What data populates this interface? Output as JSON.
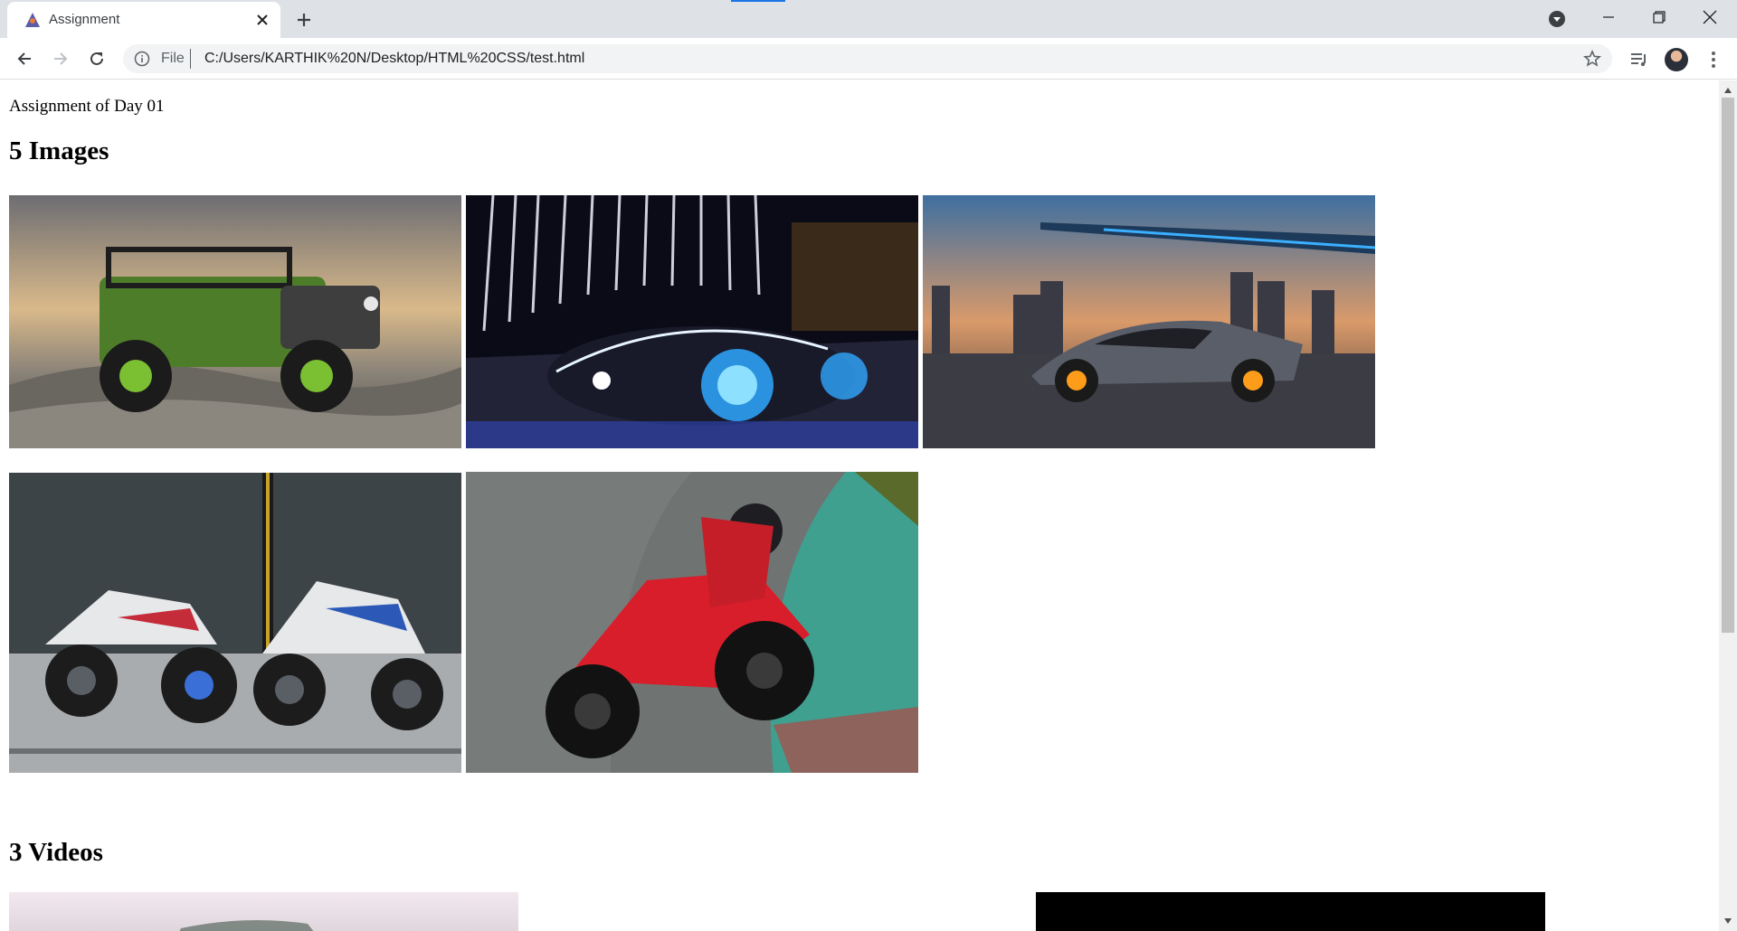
{
  "browser": {
    "tab_title": "Assignment",
    "url_scheme": "File",
    "url": "C:/Users/KARTHIK%20N/Desktop/HTML%20CSS/test.html"
  },
  "page": {
    "intro": "Assignment of Day 01",
    "images_heading": "5 Images",
    "videos_heading": "3 Videos"
  },
  "images": [
    {
      "subject": "green off-road jeep on rocks"
    },
    {
      "subject": "futuristic concept car in neon city street"
    },
    {
      "subject": "grey supercar with city skyline at dusk"
    },
    {
      "subject": "two racing motorcycles in a hangar"
    },
    {
      "subject": "red sport motorcycle leaning into a corner"
    }
  ],
  "colors": {
    "tab_strip": "#dee1e6",
    "omnibox": "#f1f3f4",
    "accent": "#1a73e8"
  }
}
